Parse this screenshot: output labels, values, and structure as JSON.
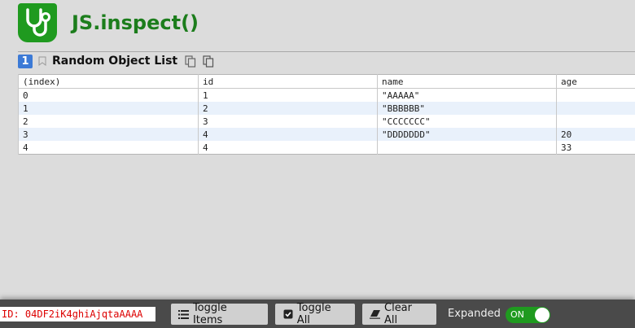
{
  "app": {
    "title": "JS.inspect()"
  },
  "section": {
    "index": "1",
    "title": "Random Object List"
  },
  "table": {
    "columns": [
      "(index)",
      "id",
      "name",
      "age"
    ],
    "rows": [
      {
        "index": "0",
        "id": "1",
        "name": "\"AAAAA\"",
        "age": ""
      },
      {
        "index": "1",
        "id": "2",
        "name": "\"BBBBBB\"",
        "age": ""
      },
      {
        "index": "2",
        "id": "3",
        "name": "\"CCCCCCC\"",
        "age": ""
      },
      {
        "index": "3",
        "id": "4",
        "name": "\"DDDDDDD\"",
        "age": "20"
      },
      {
        "index": "4",
        "id": "4",
        "name": "",
        "age": "33"
      }
    ]
  },
  "footer": {
    "id_text": "ID: 04DF2iK4ghiAjqtaAAAA",
    "toggle_items_label": "Toggle Items",
    "toggle_all_label": "Toggle All",
    "clear_all_label": "Clear All",
    "expanded_label": "Expanded",
    "expanded_switch_label": "ON"
  },
  "colors": {
    "brand": "#1f9a1f",
    "badge": "#3c7ad6",
    "id_text": "#dd0000"
  },
  "icons": [
    "stethoscope-icon",
    "bookmark-icon",
    "copy-icon",
    "list-icon",
    "checkbox-icon",
    "eraser-icon"
  ]
}
